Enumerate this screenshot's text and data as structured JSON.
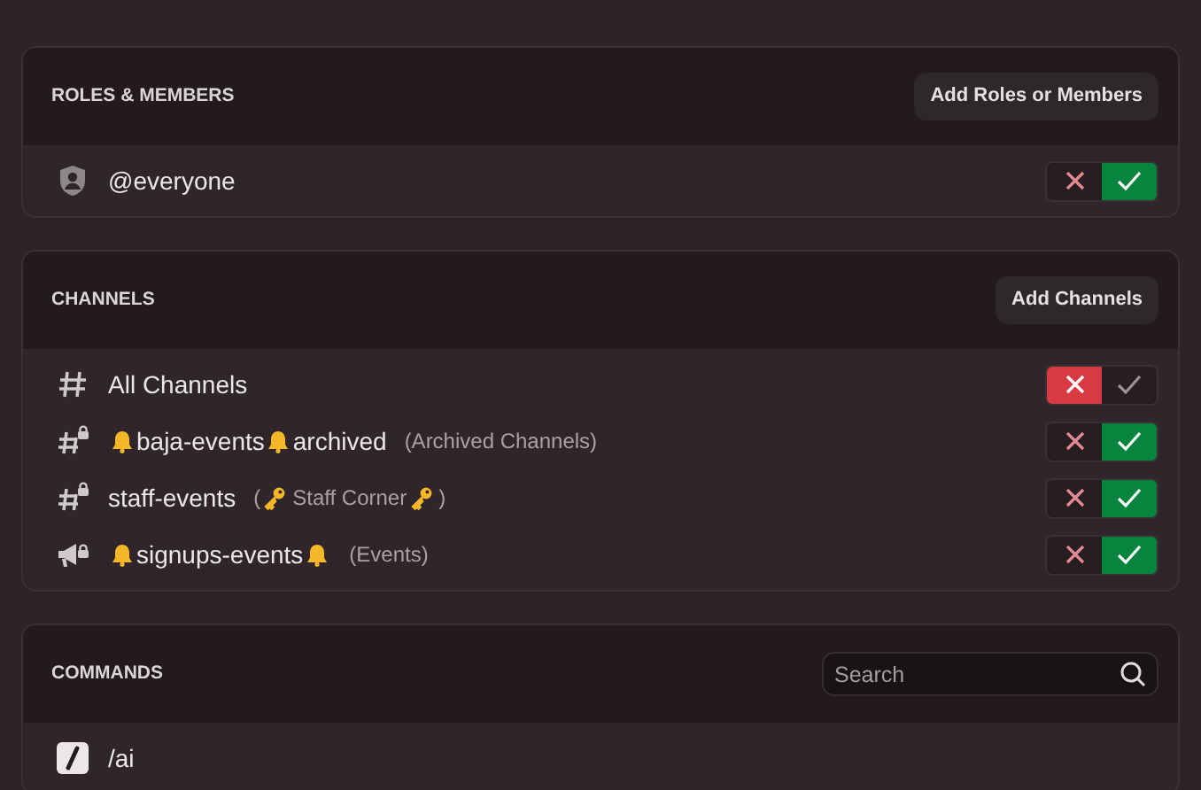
{
  "sections": [
    {
      "title": "ROLES & MEMBERS",
      "action": {
        "kind": "button",
        "label": "Add Roles or Members"
      },
      "rows": [
        {
          "kind": "role",
          "parts": [
            {
              "kind": "text",
              "text": "@everyone"
            }
          ],
          "allowed": true
        }
      ]
    },
    {
      "title": "CHANNELS",
      "action": {
        "kind": "button",
        "label": "Add Channels"
      },
      "rows": [
        {
          "kind": "channel",
          "parts": [
            {
              "kind": "text",
              "text": "All Channels"
            }
          ],
          "allowed": false
        },
        {
          "kind": "private-channel",
          "parts": [
            {
              "kind": "bell"
            },
            {
              "kind": "text",
              "text": "baja-events"
            },
            {
              "kind": "bell"
            },
            {
              "kind": "text",
              "text": "archived"
            }
          ],
          "note": [
            {
              "kind": "text",
              "text": "(Archived Channels)"
            }
          ],
          "allowed": true
        },
        {
          "kind": "private-channel",
          "parts": [
            {
              "kind": "text",
              "text": "staff-events"
            }
          ],
          "note": [
            {
              "kind": "text",
              "text": "("
            },
            {
              "kind": "key"
            },
            {
              "kind": "text",
              "text": "Staff Corner"
            },
            {
              "kind": "key"
            },
            {
              "kind": "text",
              "text": ")"
            }
          ],
          "allowed": true
        },
        {
          "kind": "private-announcement",
          "parts": [
            {
              "kind": "bell"
            },
            {
              "kind": "text",
              "text": "signups-events"
            },
            {
              "kind": "bell"
            }
          ],
          "note": [
            {
              "kind": "text",
              "text": "(Events)"
            }
          ],
          "allowed": true
        }
      ]
    },
    {
      "title": "COMMANDS",
      "action": {
        "kind": "search",
        "placeholder": "Search"
      },
      "rows": [
        {
          "kind": "command",
          "parts": [
            {
              "kind": "text",
              "text": "/ai"
            }
          ]
        }
      ]
    }
  ]
}
